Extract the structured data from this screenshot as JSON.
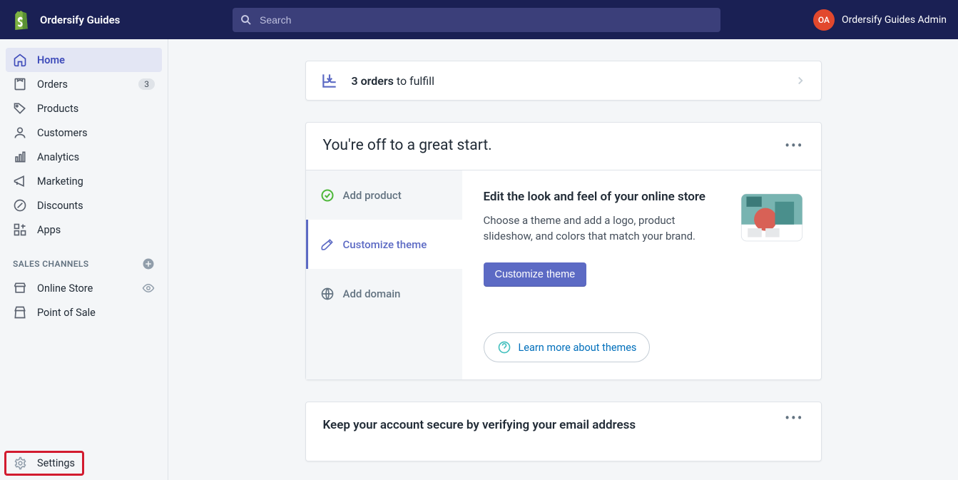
{
  "header": {
    "store_name": "Ordersify Guides",
    "search_placeholder": "Search",
    "avatar_initials": "OA",
    "admin_name": "Ordersify Guides Admin"
  },
  "sidebar": {
    "items": [
      {
        "label": "Home"
      },
      {
        "label": "Orders",
        "badge": "3"
      },
      {
        "label": "Products"
      },
      {
        "label": "Customers"
      },
      {
        "label": "Analytics"
      },
      {
        "label": "Marketing"
      },
      {
        "label": "Discounts"
      },
      {
        "label": "Apps"
      }
    ],
    "channels_header": "SALES CHANNELS",
    "channels": [
      {
        "label": "Online Store"
      },
      {
        "label": "Point of Sale"
      }
    ],
    "settings_label": "Settings"
  },
  "main": {
    "fulfill_bold": "3 orders",
    "fulfill_rest": " to fulfill",
    "onboard_title": "You're off to a great start.",
    "steps": [
      {
        "label": "Add product"
      },
      {
        "label": "Customize theme"
      },
      {
        "label": "Add domain"
      }
    ],
    "detail_title": "Edit the look and feel of your online store",
    "detail_desc": "Choose a theme and add a logo, product slideshow, and colors that match your brand.",
    "cta_label": "Customize theme",
    "learn_more": "Learn more about themes",
    "verify_title": "Keep your account secure by verifying your email address"
  }
}
